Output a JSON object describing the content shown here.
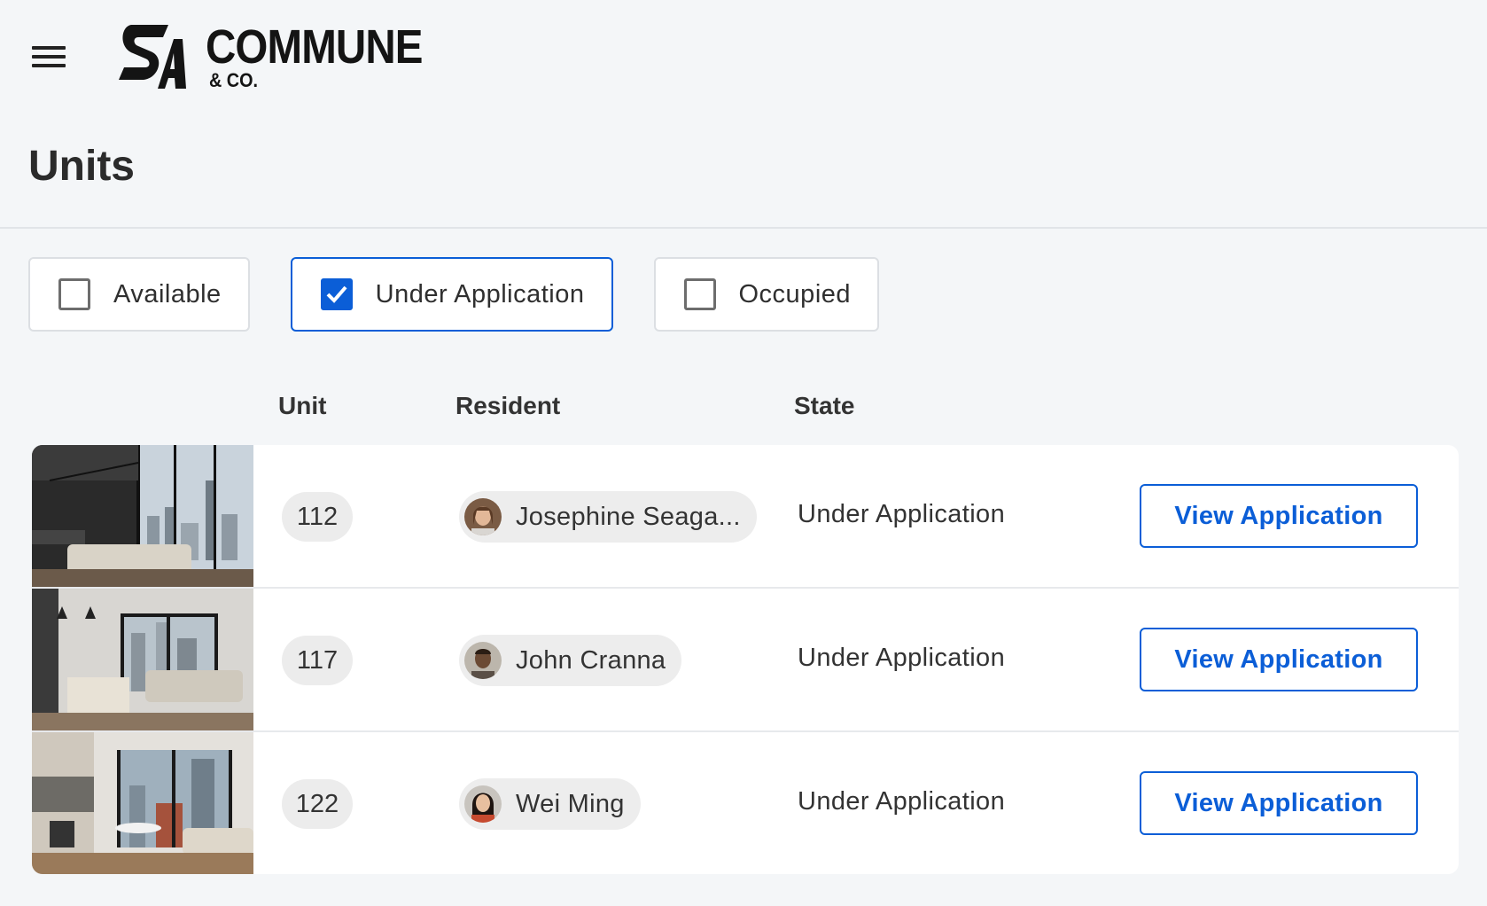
{
  "header": {
    "brand_name": "COMMUNE",
    "brand_sub": "& CO.",
    "menu_icon": "hamburger-menu-icon"
  },
  "page": {
    "title": "Units"
  },
  "filters": [
    {
      "label": "Available",
      "checked": false
    },
    {
      "label": "Under Application",
      "checked": true
    },
    {
      "label": "Occupied",
      "checked": false
    }
  ],
  "table": {
    "columns": {
      "unit": "Unit",
      "resident": "Resident",
      "state": "State"
    },
    "rows": [
      {
        "unit": "112",
        "resident": "Josephine Seaga...",
        "state": "Under Application",
        "action": "View Application"
      },
      {
        "unit": "117",
        "resident": "John Cranna",
        "state": "Under Application",
        "action": "View Application"
      },
      {
        "unit": "122",
        "resident": "Wei Ming",
        "state": "Under Application",
        "action": "View Application"
      }
    ]
  },
  "colors": {
    "accent": "#0b5ed7",
    "background": "#f4f6f8"
  }
}
